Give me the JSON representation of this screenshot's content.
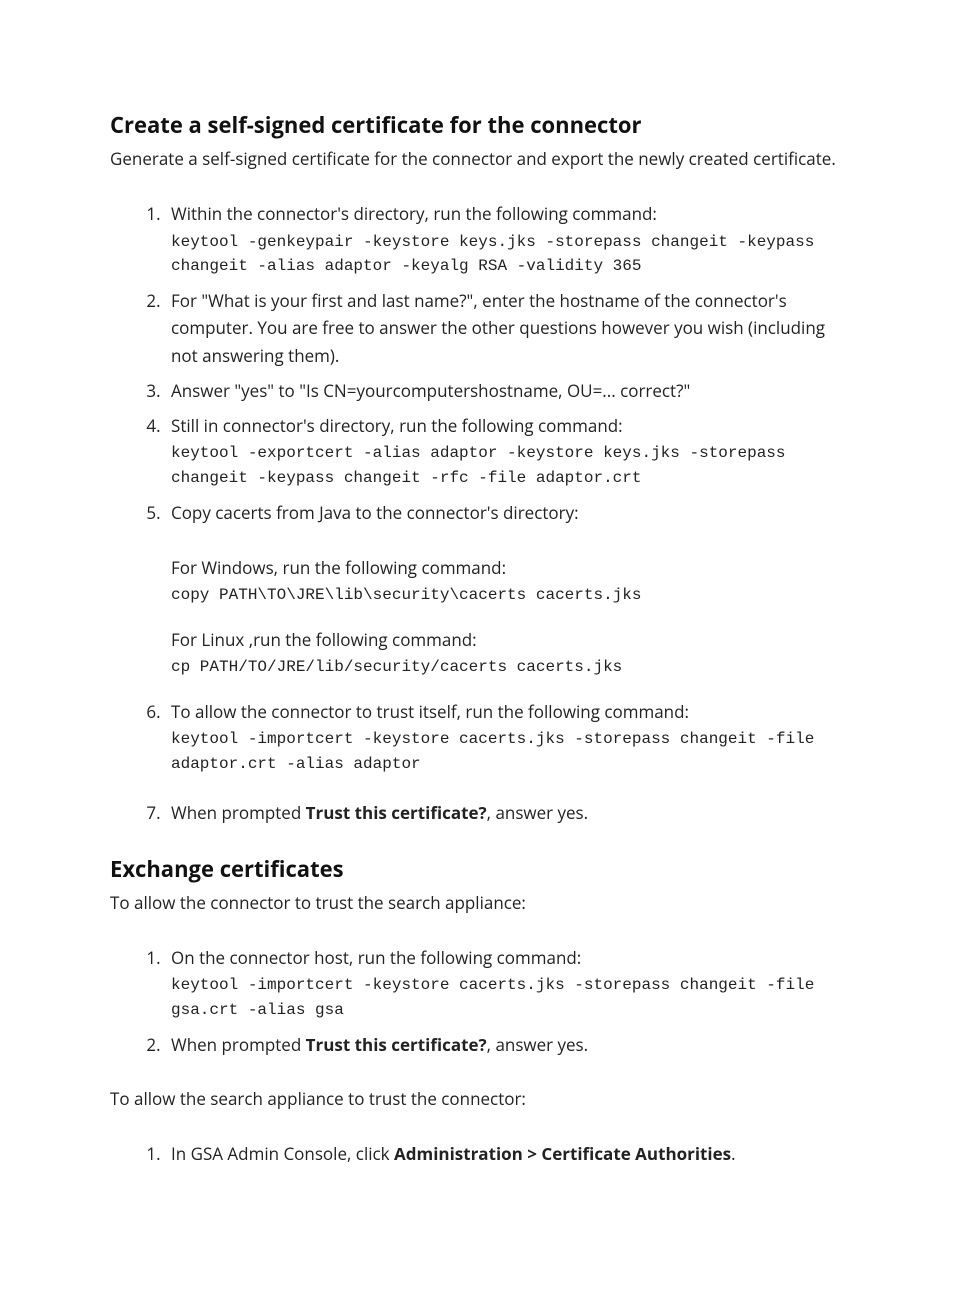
{
  "section1": {
    "heading": "Create a self-signed certificate for the connector",
    "lead": "Generate a self-signed certificate for the connector and export the newly created certificate.",
    "steps": {
      "s1": {
        "text": "Within the connector's directory, run the following command:",
        "cmd": "keytool -genkeypair -keystore keys.jks -storepass changeit -keypass changeit -alias adaptor -keyalg RSA -validity 365"
      },
      "s2": "For \"What is your first and last name?\", enter the hostname of the connector's computer. You are free to answer the other questions however you wish (including not answering them).",
      "s3": "Answer \"yes\" to \"Is CN=yourcomputershostname, OU=... correct?\"",
      "s4": {
        "text": "Still in connector's directory, run the following command:",
        "cmd": "keytool -exportcert -alias adaptor -keystore keys.jks -storepass changeit -keypass changeit -rfc -file adaptor.crt"
      },
      "s5": {
        "text": "Copy cacerts from Java to the connector's directory:",
        "win_label": "For Windows, run the following command:",
        "win_cmd": "copy PATH\\TO\\JRE\\lib\\security\\cacerts cacerts.jks",
        "lin_label": "For Linux ,run the following command:",
        "lin_cmd": "cp PATH/TO/JRE/lib/security/cacerts cacerts.jks"
      },
      "s6": {
        "text": "To allow the connector to trust itself, run the following command:",
        "cmd": "keytool -importcert -keystore cacerts.jks -storepass changeit -file adaptor.crt -alias adaptor"
      },
      "s7": {
        "pre": "When prompted ",
        "bold": "Trust this certificate?",
        "post": ", answer yes."
      }
    }
  },
  "section2": {
    "heading": "Exchange certificates",
    "lead1": "To allow the connector to trust the search appliance:",
    "stepsA": {
      "s1": {
        "text": "On the connector host, run the following command:",
        "cmd": "keytool -importcert -keystore cacerts.jks -storepass changeit -file gsa.crt -alias gsa"
      },
      "s2": {
        "pre": "When prompted ",
        "bold": "Trust this certificate?",
        "post": ", answer yes."
      }
    },
    "lead2": "To allow the search appliance to trust the connector:",
    "stepsB": {
      "s1": {
        "pre": "In GSA Admin Console, click ",
        "bold": "Administration > Certificate Authorities",
        "post": "."
      }
    }
  }
}
